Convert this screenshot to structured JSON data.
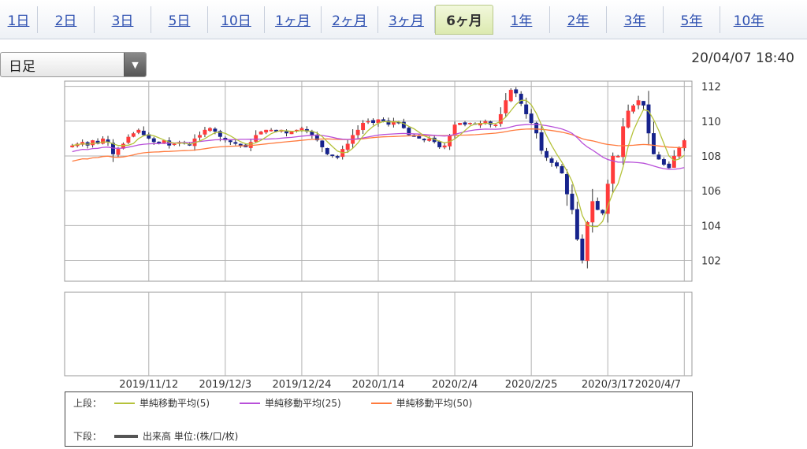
{
  "tabs": [
    {
      "label": "1日",
      "active": false
    },
    {
      "label": "2日",
      "active": false
    },
    {
      "label": "3日",
      "active": false
    },
    {
      "label": "5日",
      "active": false
    },
    {
      "label": "10日",
      "active": false
    },
    {
      "label": "1ヶ月",
      "active": false
    },
    {
      "label": "2ヶ月",
      "active": false
    },
    {
      "label": "3ヶ月",
      "active": false
    },
    {
      "label": "6ヶ月",
      "active": true
    },
    {
      "label": "1年",
      "active": false
    },
    {
      "label": "2年",
      "active": false
    },
    {
      "label": "3年",
      "active": false
    },
    {
      "label": "5年",
      "active": false
    },
    {
      "label": "10年",
      "active": false
    }
  ],
  "period_select": {
    "value": "日足",
    "arrow_icon": "triangle-down-icon"
  },
  "timestamp": "20/04/07 18:40",
  "colors": {
    "up": "#ff3b3b",
    "down": "#16238c",
    "sma5": "#b5c23a",
    "sma25": "#b84fd9",
    "sma50": "#ff7a3d",
    "grid": "#b0b0b0",
    "volume": "#555555"
  },
  "chart_data": {
    "type": "candlestick",
    "y_ticks": [
      "112",
      "110",
      "108",
      "106",
      "104",
      "102"
    ],
    "ylim": [
      100.8,
      112.3
    ],
    "x_labels": [
      "2019/11/12",
      "2019/12/3",
      "2019/12/24",
      "2020/1/14",
      "2020/2/4",
      "2020/2/25",
      "2020/3/17",
      "2020/4/7"
    ],
    "x_label_index": [
      15,
      30,
      45,
      60,
      75,
      90,
      105,
      120
    ],
    "num_bars": 121,
    "closes": [
      108.6,
      108.7,
      108.8,
      108.6,
      108.9,
      108.7,
      109.0,
      108.8,
      108.1,
      108.4,
      108.7,
      109.1,
      109.3,
      109.5,
      109.2,
      109.0,
      108.8,
      108.7,
      108.9,
      108.6,
      108.7,
      108.8,
      108.7,
      108.6,
      109.0,
      109.2,
      109.5,
      109.6,
      109.4,
      109.1,
      108.9,
      108.8,
      108.7,
      108.6,
      108.5,
      108.8,
      109.2,
      109.4,
      109.5,
      109.5,
      109.4,
      109.5,
      109.3,
      109.4,
      109.5,
      109.6,
      109.4,
      109.2,
      108.9,
      108.5,
      108.1,
      108.0,
      107.9,
      108.4,
      108.7,
      109.2,
      109.5,
      109.9,
      110.0,
      109.9,
      110.1,
      110.0,
      109.8,
      110.0,
      109.9,
      109.6,
      109.2,
      109.1,
      109.0,
      108.9,
      109.0,
      108.8,
      108.5,
      108.6,
      109.2,
      109.8,
      109.9,
      109.8,
      109.9,
      109.8,
      109.9,
      110.0,
      109.8,
      109.8,
      110.4,
      111.2,
      111.8,
      111.6,
      111.0,
      110.4,
      109.9,
      109.3,
      108.3,
      107.9,
      107.6,
      107.4,
      107.0,
      105.8,
      104.9,
      103.2,
      102.0,
      104.2,
      105.4,
      104.9,
      104.7,
      106.4,
      108.0,
      108.0,
      109.7,
      110.6,
      110.9,
      111.2,
      110.9,
      109.3,
      108.1,
      107.8,
      107.5,
      107.3,
      108.0,
      108.5,
      108.9
    ],
    "series": [
      {
        "name": "単純移動平均(5)",
        "key": "sma5"
      },
      {
        "name": "単純移動平均(25)",
        "key": "sma25"
      },
      {
        "name": "単純移動平均(50)",
        "key": "sma50"
      }
    ]
  },
  "legend": {
    "upper_label": "上段：",
    "lower_label": "下段：",
    "sma5": "単純移動平均(5)",
    "sma25": "単純移動平均(25)",
    "sma50": "単純移動平均(50)",
    "volume": "出来高 単位:(株/口/枚)"
  }
}
